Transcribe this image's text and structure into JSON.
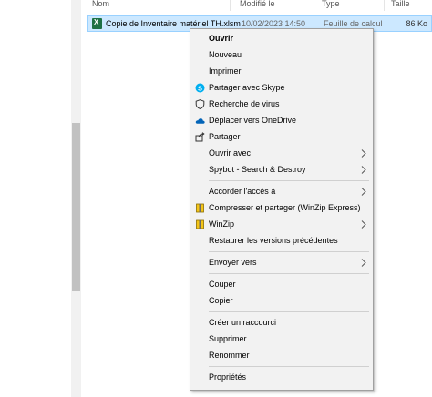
{
  "columns": {
    "name": "Nom",
    "modified": "Modifié le",
    "type": "Type",
    "size": "Taille"
  },
  "file": {
    "name": "Copie de Inventaire matériel TH.xlsm",
    "date": "10/02/2023 14:50",
    "type": "Feuille de calcul",
    "size": "86 Ko",
    "icon": "excel-file-icon"
  },
  "menu": {
    "items": [
      {
        "label": "Ouvrir",
        "icon": "",
        "submenu": false
      },
      {
        "label": "Nouveau",
        "icon": "",
        "submenu": false
      },
      {
        "label": "Imprimer",
        "icon": "",
        "submenu": false
      },
      {
        "label": "Partager avec Skype",
        "icon": "skype-icon",
        "submenu": false
      },
      {
        "label": "Recherche de virus",
        "icon": "shield-icon",
        "submenu": false
      },
      {
        "label": "Déplacer vers OneDrive",
        "icon": "onedrive-cloud-icon",
        "submenu": false
      },
      {
        "label": "Partager",
        "icon": "share-icon",
        "submenu": false
      },
      {
        "label": "Ouvrir avec",
        "icon": "",
        "submenu": true
      },
      {
        "label": "Spybot - Search & Destroy",
        "icon": "",
        "submenu": true
      },
      {
        "label": "Accorder l'accès à",
        "icon": "",
        "submenu": true
      },
      {
        "label": "Compresser et partager (WinZip Express)",
        "icon": "winzip-icon",
        "submenu": false
      },
      {
        "label": "WinZip",
        "icon": "winzip-icon",
        "submenu": true
      },
      {
        "label": "Restaurer les versions précédentes",
        "icon": "",
        "submenu": false
      },
      {
        "label": "Envoyer vers",
        "icon": "",
        "submenu": true
      },
      {
        "label": "Couper",
        "icon": "",
        "submenu": false
      },
      {
        "label": "Copier",
        "icon": "",
        "submenu": false
      },
      {
        "label": "Créer un raccourci",
        "icon": "",
        "submenu": false
      },
      {
        "label": "Supprimer",
        "icon": "",
        "submenu": false
      },
      {
        "label": "Renommer",
        "icon": "",
        "submenu": false
      },
      {
        "label": "Propriétés",
        "icon": "",
        "submenu": false
      }
    ]
  },
  "colors": {
    "selection": "#cce8ff",
    "menu_bg": "#f2f2f2",
    "skype": "#00aff0",
    "onedrive": "#0364b8",
    "excel": "#1d7044"
  }
}
